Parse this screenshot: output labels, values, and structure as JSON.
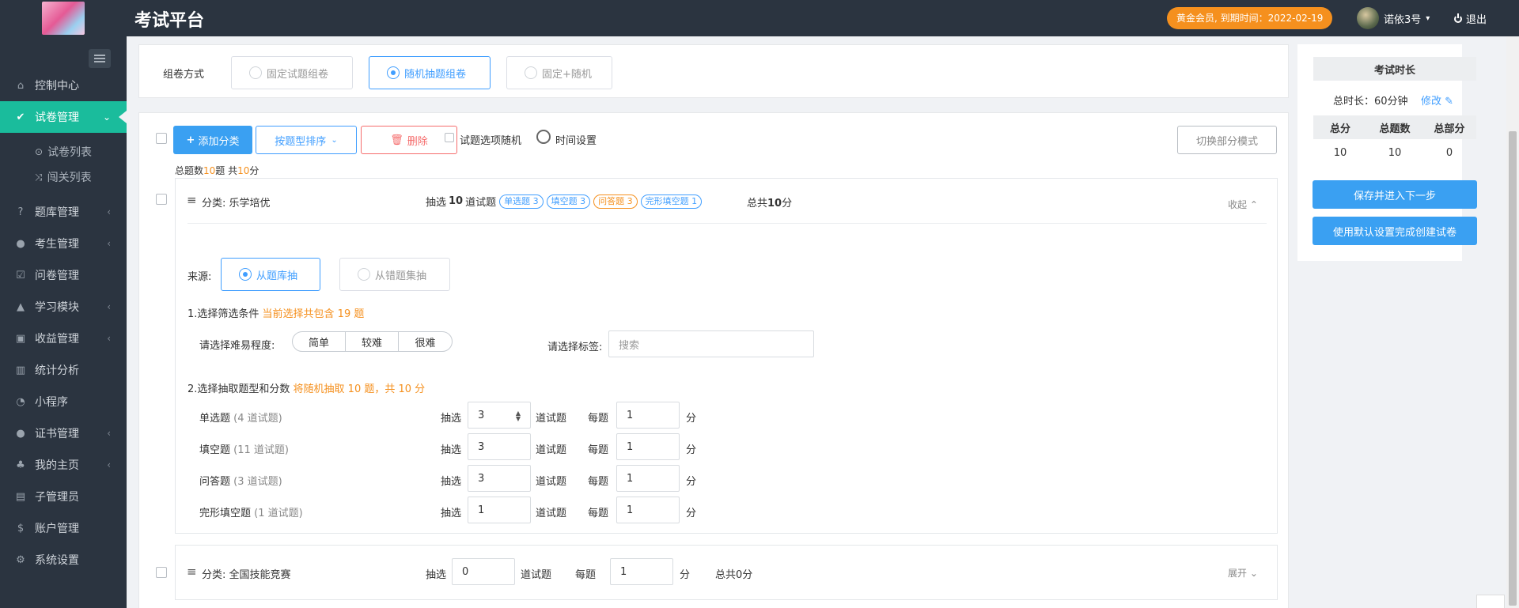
{
  "header": {
    "title": "考试平台",
    "vip_badge": "黄金会员, 到期时间：2022-02-19",
    "username": "诺依3号",
    "logout": "退出"
  },
  "sidebar": {
    "items": [
      {
        "label": "控制中心",
        "icon": "home-icon"
      },
      {
        "label": "试卷管理",
        "icon": "check-circle-icon",
        "active": true
      },
      {
        "label": "题库管理",
        "icon": "question-icon"
      },
      {
        "label": "考生管理",
        "icon": "user-icon"
      },
      {
        "label": "问卷管理",
        "icon": "checkbox-icon"
      },
      {
        "label": "学习模块",
        "icon": "graduation-cap-icon"
      },
      {
        "label": "收益管理",
        "icon": "money-icon"
      },
      {
        "label": "统计分析",
        "icon": "bar-chart-icon"
      },
      {
        "label": "小程序",
        "icon": "wechat-icon"
      },
      {
        "label": "证书管理",
        "icon": "certificate-icon"
      },
      {
        "label": "我的主页",
        "icon": "homepage-icon"
      },
      {
        "label": "子管理员",
        "icon": "sub-admin-icon"
      },
      {
        "label": "账户管理",
        "icon": "dollar-icon"
      },
      {
        "label": "系统设置",
        "icon": "gear-icon"
      }
    ],
    "subitems": [
      {
        "label": "试卷列表",
        "icon": "check-circle-icon"
      },
      {
        "label": "闯关列表",
        "icon": "shuffle-icon"
      }
    ]
  },
  "compose": {
    "label": "组卷方式",
    "options": [
      "固定试题组卷",
      "随机抽题组卷",
      "固定+随机"
    ],
    "selected": "随机抽题组卷"
  },
  "toolbar": {
    "add_category": "添加分类",
    "sort_by_type": "按题型排序",
    "delete": "删除",
    "random_options": "试题选项随机",
    "time_settings": "时间设置",
    "switch_mode": "切换部分模式"
  },
  "summary": {
    "prefix": "总题数",
    "count": "10",
    "mid": "题 共",
    "score": "10",
    "suffix": "分"
  },
  "category1": {
    "name": "分类: 乐学培优",
    "draw_prefix": "抽选",
    "draw_count": "10",
    "draw_suffix": "道试题",
    "tags": [
      "单选题 3",
      "填空题 3",
      "问答题 3",
      "完形填空题 1"
    ],
    "total_prefix": "总共",
    "total_score": "10",
    "total_suffix": "分",
    "collapse": "收起",
    "source_label": "来源:",
    "source_options": [
      "从题库抽",
      "从错题集抽"
    ],
    "step1_title": "1.选择筛选条件",
    "step1_hint": "当前选择共包含 19 题",
    "difficulty_label": "请选择难易程度:",
    "difficulty_options": [
      "简单",
      "较难",
      "很难"
    ],
    "tag_label": "请选择标签:",
    "tag_placeholder": "搜索",
    "step2_title": "2.选择抽取题型和分数",
    "step2_hint": "将随机抽取 10 题，共 10 分",
    "rows": [
      {
        "type": "单选题",
        "count_note": "(4 道试题)",
        "draw": "3",
        "each": "1"
      },
      {
        "type": "填空题",
        "count_note": "(11 道试题)",
        "draw": "3",
        "each": "1"
      },
      {
        "type": "问答题",
        "count_note": "(3 道试题)",
        "draw": "3",
        "each": "1"
      },
      {
        "type": "完形填空题",
        "count_note": "(1 道试题)",
        "draw": "1",
        "each": "1"
      }
    ],
    "draw_word": "抽选",
    "question_word": "道试题",
    "each_word": "每题",
    "score_word": "分"
  },
  "category2": {
    "name": "分类: 全国技能竞赛",
    "draw_prefix": "抽选",
    "draw_value": "0",
    "draw_suffix": "道试题",
    "each_word": "每题",
    "each_value": "1",
    "score_word": "分",
    "total": "总共0分",
    "expand": "展开"
  },
  "right_panel": {
    "duration_title": "考试时长",
    "duration_label": "总时长：60分钟",
    "modify": "修改",
    "headers": [
      "总分",
      "总题数",
      "总部分"
    ],
    "values": [
      "10",
      "10",
      "0"
    ],
    "save_next": "保存并进入下一步",
    "use_default": "使用默认设置完成创建试卷"
  },
  "colors": {
    "accent": "#1abc9c",
    "primary": "#409eff",
    "warning": "#f5901e",
    "danger": "#f56c6c"
  }
}
